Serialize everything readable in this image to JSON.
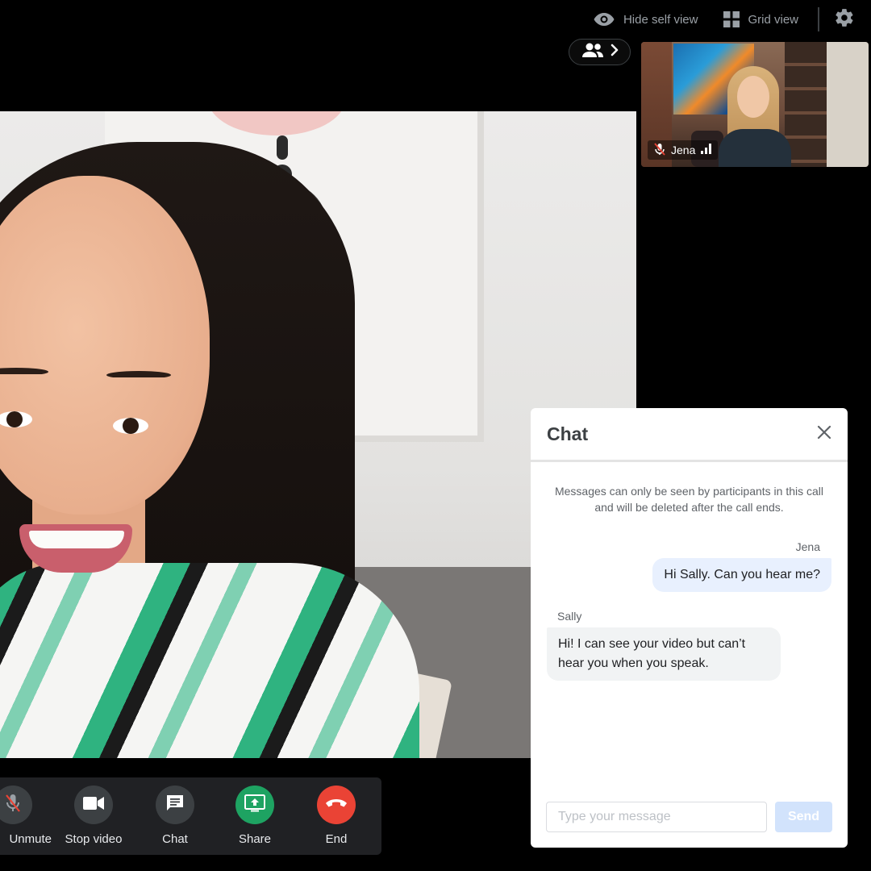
{
  "toolbar": {
    "hide_self_view_label": "Hide self view",
    "hide_self_view_icon": "eye-icon",
    "grid_view_label": "Grid view",
    "grid_view_icon": "grid-icon",
    "settings_icon": "gear-icon"
  },
  "participants_button": {
    "icon": "people-icon",
    "arrow_icon": "chevron-right-icon"
  },
  "self_view": {
    "name": "Jena",
    "mic_state": "muted",
    "signal_icon": "signal-bars-icon"
  },
  "controls": [
    {
      "id": "unmute",
      "label": "Unmute",
      "icon": "mic-off-icon"
    },
    {
      "id": "stop_video",
      "label": "Stop video",
      "icon": "video-camera-icon"
    },
    {
      "id": "chat",
      "label": "Chat",
      "icon": "chat-bubble-icon"
    },
    {
      "id": "share",
      "label": "Share",
      "icon": "screen-share-icon",
      "color": "#1ea362"
    },
    {
      "id": "end",
      "label": "End",
      "icon": "phone-hangup-icon",
      "color": "#ea4335"
    }
  ],
  "chat": {
    "title": "Chat",
    "notice": "Messages can only be seen by participants in this call and will be deleted after the call ends.",
    "messages": [
      {
        "sender": "Jena",
        "text": "Hi Sally. Can you hear me?",
        "direction": "outgoing"
      },
      {
        "sender": "Sally",
        "text": "Hi! I can see your video but can’t hear you when you speak.",
        "direction": "incoming"
      }
    ],
    "input_placeholder": "Type your message",
    "input_value": "",
    "send_label": "Send"
  },
  "colors": {
    "background": "#000000",
    "control_bar": "#202124",
    "share_green": "#1ea362",
    "end_red": "#ea4335",
    "outgoing_bubble": "#e8f0fe",
    "incoming_bubble": "#f1f3f4",
    "send_disabled": "#d2e3fc"
  }
}
